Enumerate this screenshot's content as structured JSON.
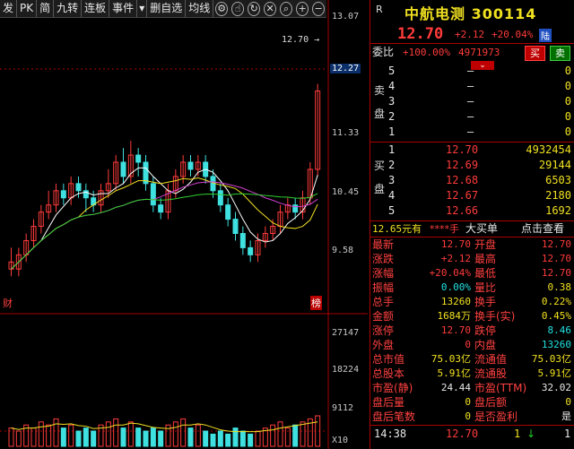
{
  "toolbar": {
    "items": [
      "发",
      "PK",
      "简",
      "九转",
      "连板",
      "事件",
      "删自选",
      "均线"
    ],
    "icons": [
      "settings-icon",
      "hand-icon",
      "refresh-icon",
      "close-icon",
      "zoom-in-icon",
      "plus-icon",
      "minus-icon"
    ]
  },
  "chart": {
    "price_labels": [
      "13.07",
      "12.27",
      "11.33",
      "10.45",
      "9.58"
    ],
    "volume_labels": [
      "27147",
      "18224",
      "9112"
    ],
    "last_price_tag": "12.70",
    "left_badge": "财",
    "right_badge": "榜",
    "vol_unit": "X10",
    "chart_data": {
      "type": "candlestick",
      "price_range": [
        9.2,
        13.2
      ],
      "volume_range": [
        0,
        30000
      ],
      "candles": [
        [
          9.8,
          9.7,
          10.0,
          9.6,
          1
        ],
        [
          9.7,
          9.9,
          10.0,
          9.6,
          1
        ],
        [
          9.9,
          10.1,
          10.2,
          9.8,
          1
        ],
        [
          10.1,
          10.3,
          10.4,
          10.0,
          1
        ],
        [
          10.3,
          10.5,
          10.6,
          10.2,
          1
        ],
        [
          10.5,
          10.6,
          10.8,
          10.4,
          1
        ],
        [
          10.6,
          10.8,
          10.9,
          10.5,
          1
        ],
        [
          10.8,
          10.7,
          10.9,
          10.6,
          0
        ],
        [
          10.7,
          10.9,
          11.0,
          10.6,
          1
        ],
        [
          10.9,
          10.8,
          11.0,
          10.7,
          0
        ],
        [
          10.8,
          10.7,
          10.9,
          10.5,
          0
        ],
        [
          10.7,
          10.6,
          10.8,
          10.5,
          0
        ],
        [
          10.6,
          10.8,
          10.9,
          10.5,
          1
        ],
        [
          10.8,
          10.9,
          11.1,
          10.7,
          1
        ],
        [
          10.9,
          11.2,
          11.3,
          10.8,
          1
        ],
        [
          11.2,
          11.0,
          11.4,
          10.9,
          0
        ],
        [
          11.0,
          11.3,
          11.5,
          10.9,
          1
        ],
        [
          11.3,
          11.2,
          11.4,
          11.0,
          0
        ],
        [
          11.2,
          10.9,
          11.3,
          10.8,
          0
        ],
        [
          10.9,
          10.6,
          11.0,
          10.5,
          0
        ],
        [
          10.6,
          10.5,
          10.7,
          10.4,
          0
        ],
        [
          10.5,
          10.8,
          10.9,
          10.4,
          1
        ],
        [
          10.8,
          11.0,
          11.1,
          10.7,
          1
        ],
        [
          11.0,
          11.2,
          11.3,
          10.9,
          1
        ],
        [
          11.2,
          11.1,
          11.3,
          11.0,
          0
        ],
        [
          11.1,
          11.2,
          11.3,
          11.0,
          1
        ],
        [
          11.2,
          11.0,
          11.3,
          10.9,
          0
        ],
        [
          11.0,
          10.8,
          11.1,
          10.7,
          0
        ],
        [
          10.8,
          10.6,
          10.9,
          10.5,
          0
        ],
        [
          10.6,
          10.4,
          10.7,
          10.3,
          0
        ],
        [
          10.4,
          10.2,
          10.5,
          10.1,
          0
        ],
        [
          10.2,
          10.0,
          10.3,
          9.9,
          0
        ],
        [
          10.0,
          9.9,
          10.1,
          9.8,
          0
        ],
        [
          9.9,
          10.1,
          10.2,
          9.8,
          1
        ],
        [
          10.1,
          10.2,
          10.3,
          10.0,
          1
        ],
        [
          10.2,
          10.3,
          10.4,
          10.1,
          1
        ],
        [
          10.3,
          10.5,
          10.6,
          10.2,
          1
        ],
        [
          10.5,
          10.6,
          10.7,
          10.4,
          1
        ],
        [
          10.6,
          10.5,
          10.7,
          10.4,
          0
        ],
        [
          10.5,
          10.7,
          10.8,
          10.4,
          1
        ],
        [
          10.7,
          11.1,
          11.2,
          10.6,
          1
        ],
        [
          11.1,
          12.2,
          12.3,
          11.0,
          1
        ]
      ],
      "volumes": [
        6,
        5,
        7,
        6,
        8,
        7,
        9,
        6,
        7,
        5,
        6,
        5,
        7,
        8,
        9,
        6,
        8,
        6,
        5,
        6,
        5,
        7,
        8,
        9,
        6,
        7,
        5,
        4,
        5,
        4,
        6,
        5,
        4,
        5,
        6,
        7,
        8,
        6,
        7,
        8,
        9,
        10
      ]
    }
  },
  "quote": {
    "name": "中航电测",
    "code": "300114",
    "r_tag": "R",
    "price": "12.70",
    "change": "+2.12",
    "change_pct": "+20.04%",
    "board": "陆",
    "weibi_label": "委比",
    "weibi_value": "+100.00%",
    "weicha_value": "4971973",
    "buy_label": "买",
    "sell_label": "卖",
    "sell_side_label": "卖盘",
    "buy_side_label": "买盘",
    "asks": [
      {
        "lvl": "5",
        "price": "–",
        "vol": "0"
      },
      {
        "lvl": "4",
        "price": "–",
        "vol": "0"
      },
      {
        "lvl": "3",
        "price": "–",
        "vol": "0"
      },
      {
        "lvl": "2",
        "price": "–",
        "vol": "0"
      },
      {
        "lvl": "1",
        "price": "–",
        "vol": "0"
      }
    ],
    "bids": [
      {
        "lvl": "1",
        "price": "12.70",
        "vol": "4932454"
      },
      {
        "lvl": "2",
        "price": "12.69",
        "vol": "29144"
      },
      {
        "lvl": "3",
        "price": "12.68",
        "vol": "6503"
      },
      {
        "lvl": "4",
        "price": "12.67",
        "vol": "2180"
      },
      {
        "lvl": "5",
        "price": "12.66",
        "vol": "1692"
      }
    ],
    "big_order": {
      "price": "12.65元有",
      "hands": "****手",
      "label": "大买单",
      "link": "点击查看"
    },
    "stats": [
      {
        "l1": "最新",
        "v1": "12.70",
        "c1": "red",
        "l2": "开盘",
        "v2": "12.70",
        "c2": "red"
      },
      {
        "l1": "涨跌",
        "v1": "+2.12",
        "c1": "red",
        "l2": "最高",
        "v2": "12.70",
        "c2": "red"
      },
      {
        "l1": "涨幅",
        "v1": "+20.04%",
        "c1": "red",
        "l2": "最低",
        "v2": "12.70",
        "c2": "red"
      },
      {
        "l1": "振幅",
        "v1": "0.00%",
        "c1": "cyan",
        "l2": "量比",
        "v2": "0.38",
        "c2": "yellow"
      },
      {
        "l1": "总手",
        "v1": "13260",
        "c1": "yellow",
        "l2": "换手",
        "v2": "0.22%",
        "c2": "yellow"
      },
      {
        "l1": "金额",
        "v1": "1684万",
        "c1": "yellow",
        "l2": "换手(实)",
        "v2": "0.45%",
        "c2": "yellow"
      },
      {
        "l1": "涨停",
        "v1": "12.70",
        "c1": "red",
        "l2": "跌停",
        "v2": "8.46",
        "c2": "cyan"
      },
      {
        "l1": "外盘",
        "v1": "0",
        "c1": "red",
        "l2": "内盘",
        "v2": "13260",
        "c2": "cyan"
      },
      {
        "l1": "总市值",
        "v1": "75.03亿",
        "c1": "yellow",
        "l2": "流通值",
        "v2": "75.03亿",
        "c2": "yellow"
      },
      {
        "l1": "总股本",
        "v1": "5.91亿",
        "c1": "yellow",
        "l2": "流通股",
        "v2": "5.91亿",
        "c2": "yellow"
      },
      {
        "l1": "市盈(静)",
        "v1": "24.44",
        "c1": "white",
        "l2": "市盈(TTM)",
        "v2": "32.02",
        "c2": "white"
      },
      {
        "l1": "盘后量",
        "v1": "0",
        "c1": "yellow",
        "l2": "盘后额",
        "v2": "0",
        "c2": "yellow"
      },
      {
        "l1": "盘后笔数",
        "v1": "0",
        "c1": "yellow",
        "l2": "是否盈利",
        "v2": "是",
        "c2": "white"
      }
    ],
    "ticks": [
      {
        "time": "14:38",
        "price": "12.70",
        "vol": "1",
        "flag": "↓",
        "n": "1"
      }
    ]
  }
}
